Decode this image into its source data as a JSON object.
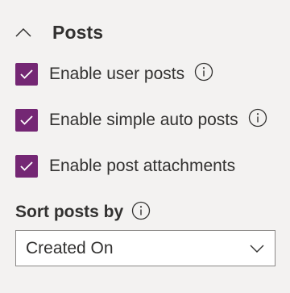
{
  "section": {
    "title": "Posts",
    "expanded": true
  },
  "options": [
    {
      "label": "Enable user posts",
      "checked": true,
      "has_info": true
    },
    {
      "label": "Enable simple auto posts",
      "checked": true,
      "has_info": true
    },
    {
      "label": "Enable post attachments",
      "checked": true,
      "has_info": false
    }
  ],
  "sort": {
    "label": "Sort posts by",
    "selected": "Created On"
  },
  "colors": {
    "accent": "#742774",
    "background": "#f3f2f1",
    "text": "#323130"
  },
  "icons": {
    "collapse": "chevron-up-icon",
    "checkbox": "checkmark-icon",
    "info": "info-icon",
    "dropdown": "chevron-down-icon"
  }
}
